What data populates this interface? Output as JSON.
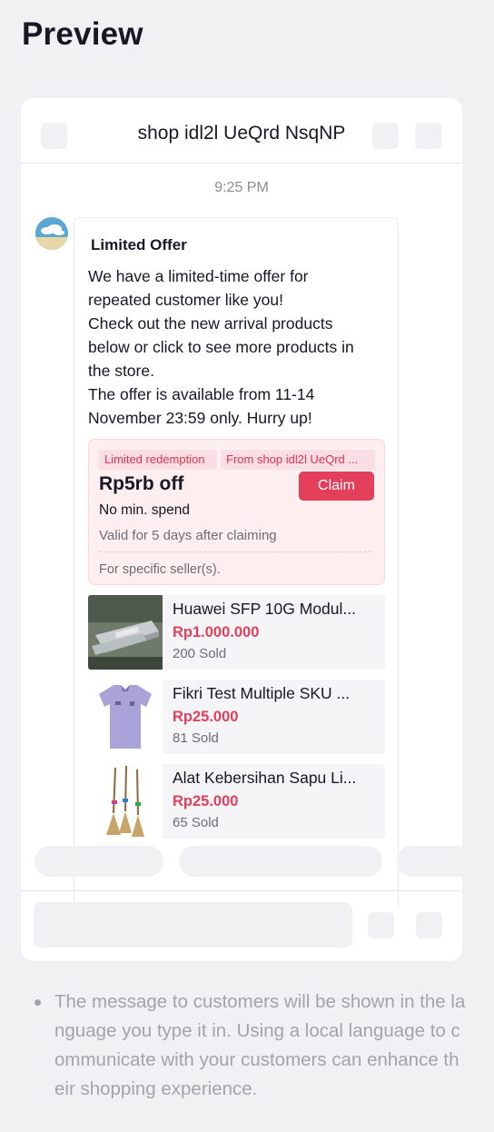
{
  "page": {
    "title": "Preview"
  },
  "chat": {
    "shop_name": "shop idl2l UeQrd NsqNP",
    "time": "9:25 PM",
    "message": {
      "title": "Limited Offer",
      "lines": [
        "We have a limited-time offer for",
        "repeated customer like you!",
        "Check out the new arrival products",
        "below or click to see more products in",
        "the store.",
        "The offer is available from 11-14",
        "November 23:59 only. Hurry up!"
      ]
    },
    "voucher": {
      "tag_redemption": "Limited redemption",
      "tag_shop": "From shop idl2l UeQrd ...",
      "amount": "Rp5rb off",
      "claim_label": "Claim",
      "min_spend": "No min. spend",
      "validity": "Valid for 5 days after claiming",
      "scope": "For specific seller(s)."
    },
    "products": [
      {
        "name": "Huawei SFP 10G Modul...",
        "price": "Rp1.000.000",
        "sold": "200 Sold",
        "image": "sfp-module"
      },
      {
        "name": "Fikri Test Multiple SKU ...",
        "price": "Rp25.000",
        "sold": "81 Sold",
        "image": "jersey"
      },
      {
        "name": "Alat Kebersihan Sapu Li...",
        "price": "Rp25.000",
        "sold": "65 Sold",
        "image": "brooms"
      }
    ]
  },
  "note": "The message to customers will be shown in the language you type it in. Using a local language to communicate with your customers can enhance their shopping experience.",
  "colors": {
    "accent": "#e43f5a",
    "voucher_bg": "#fdeef0",
    "page_bg": "#f1f1f3"
  }
}
